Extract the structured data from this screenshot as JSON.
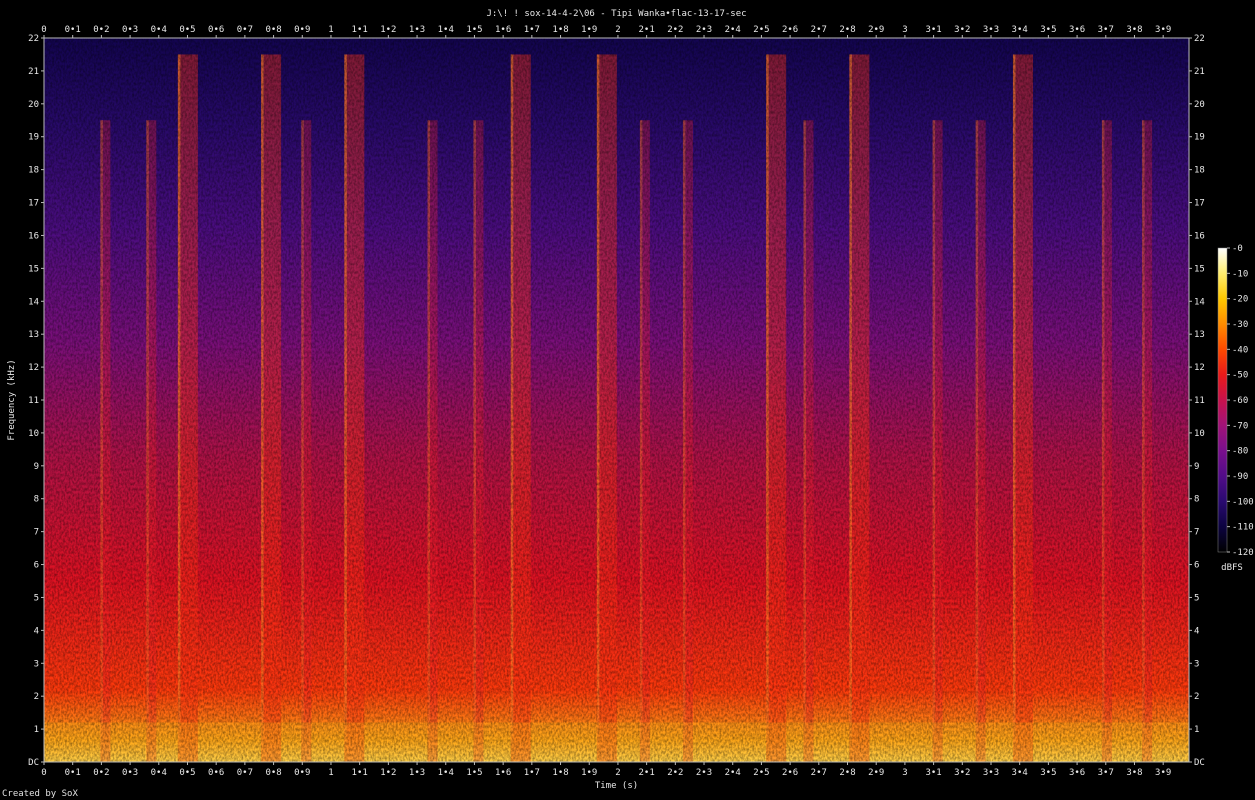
{
  "chart_data": {
    "type": "heatmap",
    "title": "J:\\! ! sox-14-4-2\\06 - Tipi Wanka•flac-13-17-sec",
    "xlabel": "Time (s)",
    "ylabel": "Frequency (kHz)",
    "xlim": [
      0,
      3.99
    ],
    "ylim": [
      0,
      22
    ],
    "x_ticks": [
      "0",
      "0•1",
      "0•2",
      "0•3",
      "0•4",
      "0•5",
      "0•6",
      "0•7",
      "0•8",
      "0•9",
      "1",
      "1•1",
      "1•2",
      "1•3",
      "1•4",
      "1•5",
      "1•6",
      "1•7",
      "1•8",
      "1•9",
      "2",
      "2•1",
      "2•2",
      "2•3",
      "2•4",
      "2•5",
      "2•6",
      "2•7",
      "2•8",
      "2•9",
      "3",
      "3•1",
      "3•2",
      "3•3",
      "3•4",
      "3•5",
      "3•6",
      "3•7",
      "3•8",
      "3•9"
    ],
    "y_ticks": [
      "DC",
      "1",
      "2",
      "3",
      "4",
      "5",
      "6",
      "7",
      "8",
      "9",
      "10",
      "11",
      "12",
      "13",
      "14",
      "15",
      "16",
      "17",
      "18",
      "19",
      "20",
      "21",
      "22"
    ],
    "colorbar": {
      "label": "dBFS",
      "range": [
        -120,
        0
      ],
      "ticks": [
        "-0",
        "-10",
        "-20",
        "-30",
        "-40",
        "-50",
        "-60",
        "-70",
        "-80",
        "-90",
        "-100",
        "-110",
        "-120"
      ],
      "colors": [
        "#000000",
        "#0c0340",
        "#2a0a70",
        "#520c88",
        "#7a0f8c",
        "#a21378",
        "#c8124c",
        "#ea1a1a",
        "#ff4a00",
        "#ff8c00",
        "#ffc800",
        "#ffee70",
        "#ffffff"
      ]
    },
    "onsets_s": [
      0.2,
      0.36,
      0.47,
      0.76,
      0.9,
      1.05,
      1.34,
      1.5,
      1.63,
      1.93,
      2.08,
      2.23,
      2.52,
      2.65,
      2.81,
      3.1,
      3.25,
      3.38,
      3.69,
      3.83
    ],
    "strong_onsets_s": [
      0.47,
      0.76,
      1.05,
      1.63,
      1.93,
      2.52,
      2.81,
      3.38
    ]
  },
  "footer": {
    "credit": "Created by SoX"
  }
}
